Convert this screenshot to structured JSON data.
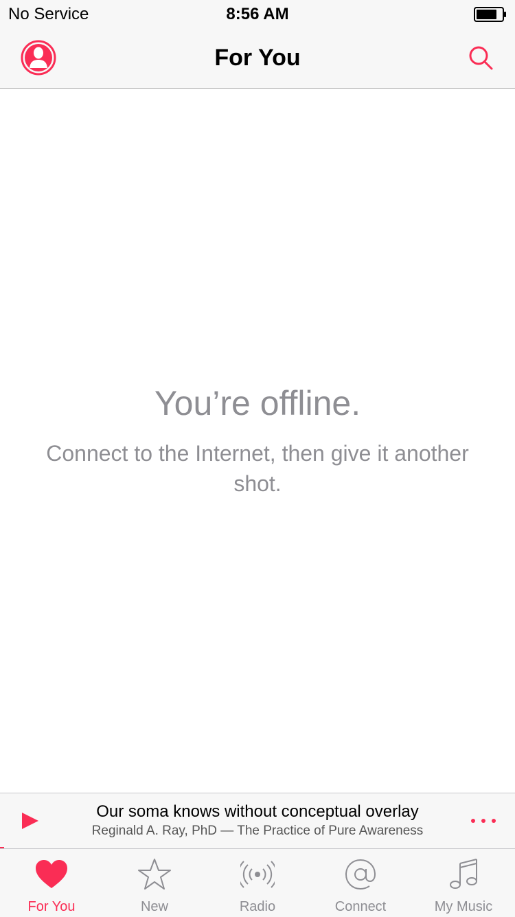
{
  "status_bar": {
    "carrier": "No Service",
    "time": "8:56 AM",
    "battery_level": 0.8
  },
  "nav": {
    "title": "For You",
    "left_icon": "profile-icon",
    "right_icon": "search-icon"
  },
  "offline": {
    "title": "You’re offline.",
    "message": "Connect to the Internet, then give it another shot."
  },
  "mini_player": {
    "title": "Our soma knows without conceptual overlay",
    "subtitle": "Reginald A. Ray, PhD — The Practice of Pure Awareness",
    "play_icon": "play-icon",
    "more_icon": "more-icon"
  },
  "tabs": [
    {
      "label": "For You",
      "icon": "heart-icon",
      "active": true
    },
    {
      "label": "New",
      "icon": "star-icon",
      "active": false
    },
    {
      "label": "Radio",
      "icon": "radio-icon",
      "active": false
    },
    {
      "label": "Connect",
      "icon": "at-icon",
      "active": false
    },
    {
      "label": "My Music",
      "icon": "music-note-icon",
      "active": false
    }
  ],
  "colors": {
    "accent": "#fa2d55",
    "muted_text": "#8e8e93",
    "bar_background": "#f7f7f7"
  }
}
